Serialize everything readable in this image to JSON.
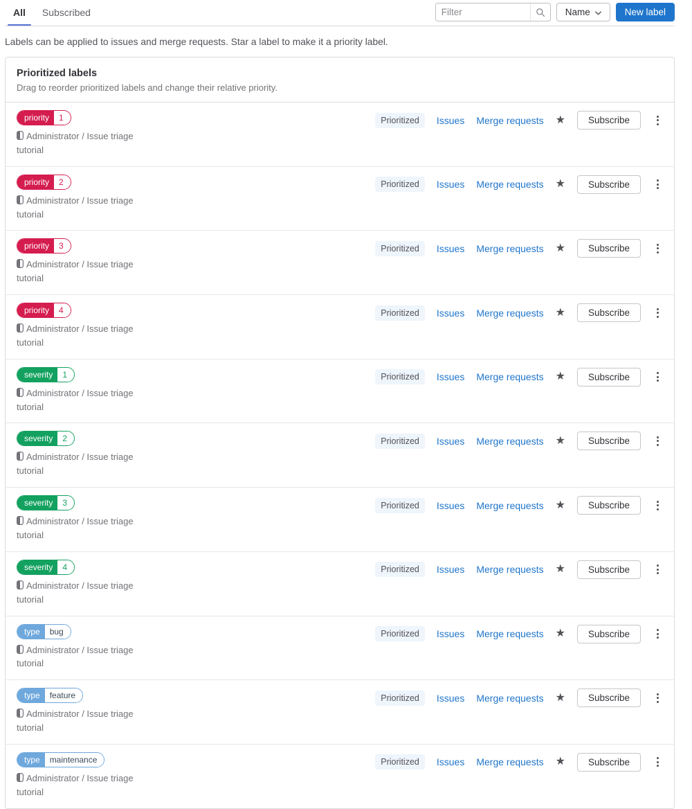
{
  "tabs": [
    {
      "label": "All",
      "active": true
    },
    {
      "label": "Subscribed",
      "active": false
    }
  ],
  "toolbar": {
    "filter_placeholder": "Filter",
    "sort_label": "Name",
    "new_label_button": "New label"
  },
  "description": "Labels can be applied to issues and merge requests. Star a label to make it a priority label.",
  "card": {
    "title": "Prioritized labels",
    "subtitle": "Drag to reorder prioritized labels and change their relative priority."
  },
  "row_common": {
    "project": "Administrator / Issue triage tutorial",
    "prioritized_badge": "Prioritized",
    "issues_link": "Issues",
    "merge_requests_link": "Merge requests",
    "subscribe_button": "Subscribe"
  },
  "labels": [
    {
      "scope": "priority",
      "value": "1",
      "color": "#d51c4f",
      "value_color": "#d51c4f"
    },
    {
      "scope": "priority",
      "value": "2",
      "color": "#d51c4f",
      "value_color": "#d51c4f"
    },
    {
      "scope": "priority",
      "value": "3",
      "color": "#d51c4f",
      "value_color": "#d51c4f"
    },
    {
      "scope": "priority",
      "value": "4",
      "color": "#d51c4f",
      "value_color": "#d51c4f"
    },
    {
      "scope": "severity",
      "value": "1",
      "color": "#13a15f",
      "value_color": "#13a15f"
    },
    {
      "scope": "severity",
      "value": "2",
      "color": "#13a15f",
      "value_color": "#13a15f"
    },
    {
      "scope": "severity",
      "value": "3",
      "color": "#13a15f",
      "value_color": "#13a15f"
    },
    {
      "scope": "severity",
      "value": "4",
      "color": "#13a15f",
      "value_color": "#13a15f"
    },
    {
      "scope": "type",
      "value": "bug",
      "color": "#6fa8dc",
      "value_color": "#3a4a5a"
    },
    {
      "scope": "type",
      "value": "feature",
      "color": "#6fa8dc",
      "value_color": "#3a4a5a"
    },
    {
      "scope": "type",
      "value": "maintenance",
      "color": "#6fa8dc",
      "value_color": "#3a4a5a"
    }
  ],
  "colors": {
    "link": "#1f75cb",
    "primary_button": "#1f75cb",
    "tab_indicator": "#5772d6"
  }
}
